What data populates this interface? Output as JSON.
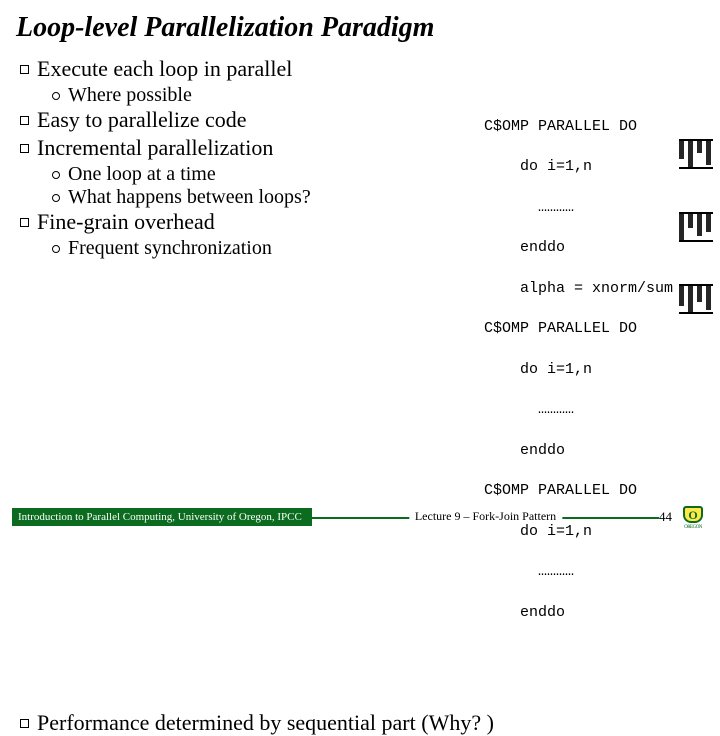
{
  "title": "Loop-level Parallelization Paradigm",
  "bullets": {
    "b1": "Execute each loop in parallel",
    "b1a": "Where possible",
    "b2": "Easy to parallelize code",
    "b3": "Incremental parallelization",
    "b3a": "One loop at a time",
    "b3b": "What happens between loops?",
    "b4": "Fine-grain overhead",
    "b4a": "Frequent synchronization",
    "b5": "Performance determined by sequential part (Why? )"
  },
  "code": {
    "l1": "C$OMP PARALLEL DO",
    "l2": "    do i=1,n",
    "l3": "      …………",
    "l4": "    enddo",
    "l5": "    alpha = xnorm/sum",
    "l6": "C$OMP PARALLEL DO",
    "l7": "    do i=1,n",
    "l8": "      …………",
    "l9": "    enddo",
    "l10": "C$OMP PARALLEL DO",
    "l11": "    do i=1,n",
    "l12": "      …………",
    "l13": "    enddo"
  },
  "footer": {
    "left": "Introduction to Parallel Computing, University of Oregon, IPCC",
    "center": "Lecture 9 – Fork-Join Pattern",
    "page": "44"
  },
  "logo": {
    "letter": "O",
    "sub": "OREGON"
  }
}
